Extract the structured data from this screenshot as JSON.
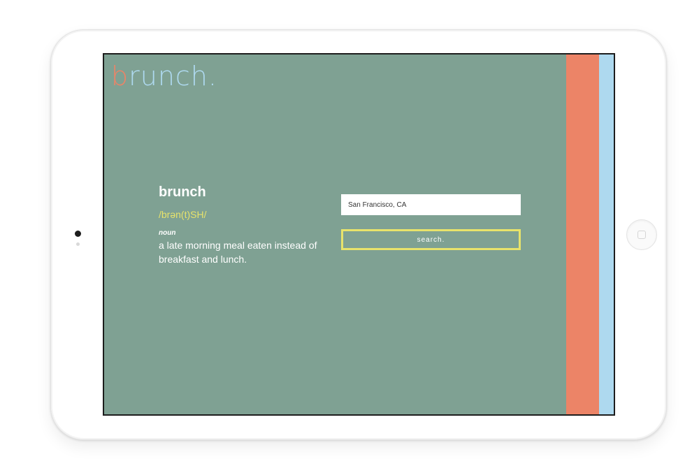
{
  "app": {
    "logo_first": "b",
    "logo_rest": "runch."
  },
  "definition": {
    "word": "brunch",
    "phonetic": "/brən(t)SH/",
    "part_of_speech": "noun",
    "meaning": "a late morning meal eaten instead of breakfast and lunch."
  },
  "search": {
    "value": "San Francisco, CA",
    "button_label": "search."
  },
  "colors": {
    "screen_bg": "#7fa193",
    "accent_orange": "#ec8467",
    "accent_blue": "#aed9ef",
    "accent_yellow": "#e8e36b"
  },
  "icons": {
    "home_button": "home-button-icon",
    "camera": "camera-icon"
  }
}
